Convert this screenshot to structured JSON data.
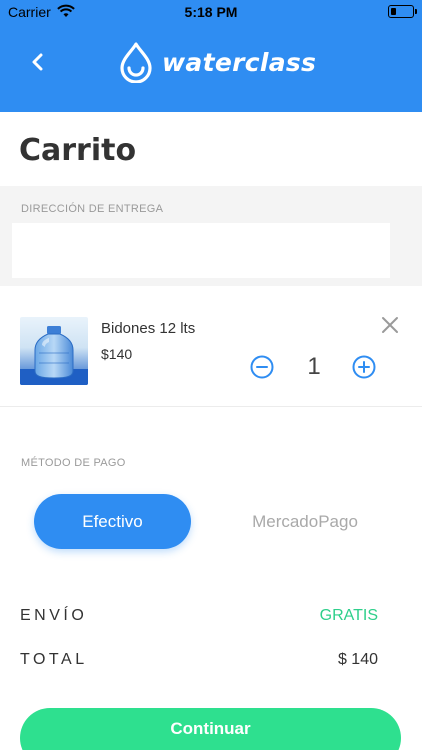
{
  "status_bar": {
    "carrier": "Carrier",
    "time": "5:18 PM"
  },
  "header": {
    "brand": "waterclass"
  },
  "page": {
    "title": "Carrito"
  },
  "address": {
    "label": "DIRECCIÓN DE ENTREGA",
    "value": ""
  },
  "cart_item": {
    "name": "Bidones 12 lts",
    "price": "$140",
    "quantity": "1"
  },
  "payment": {
    "label": "MÉTODO DE PAGO",
    "options": [
      "Efectivo",
      "MercadoPago"
    ],
    "selected": "Efectivo"
  },
  "summary": {
    "shipping_label": "ENVÍO",
    "shipping_value": "GRATIS",
    "total_label": "TOTAL",
    "total_value": "$ 140"
  },
  "actions": {
    "continue_label": "Continuar"
  },
  "colors": {
    "primary": "#2f8df2",
    "success": "#2ee08f",
    "free_text": "#2ecf8b"
  }
}
